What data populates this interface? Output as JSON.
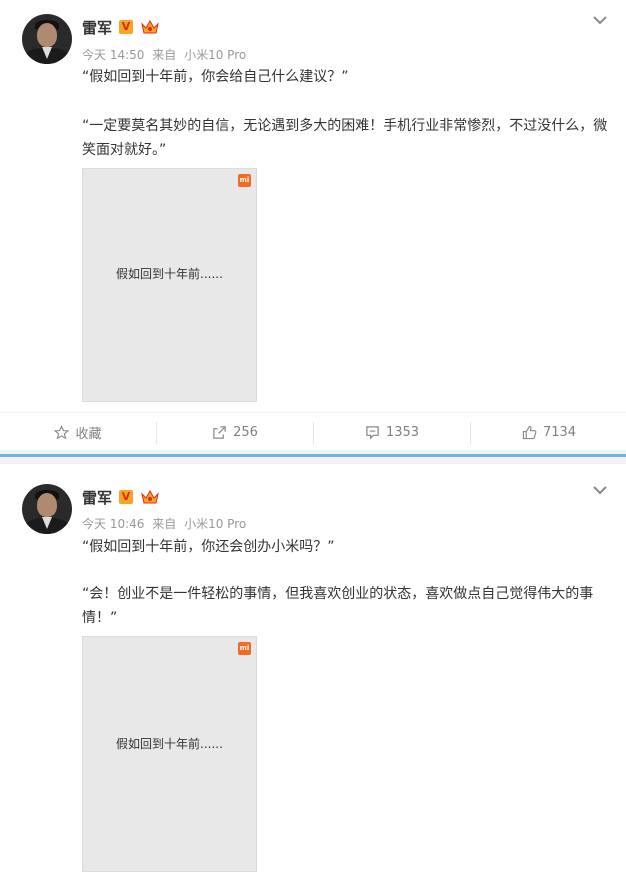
{
  "posts": [
    {
      "username": "雷军",
      "badge": "V",
      "time": "今天 14:50",
      "source_prefix": "来自",
      "source": "小米10 Pro",
      "question": "“假如回到十年前，你会给自己什么建议？”",
      "answer": "“一定要莫名其妙的自信，无论遇到多大的困难！手机行业非常惨烈，不过没什么，微笑面对就好。”",
      "image_caption": "假如回到十年前......",
      "image_logo": "mi",
      "actions": {
        "favorite": "收藏",
        "repost": "256",
        "comment": "1353",
        "like": "7134"
      }
    },
    {
      "username": "雷军",
      "badge": "V",
      "time": "今天 10:46",
      "source_prefix": "来自",
      "source": "小米10 Pro",
      "question": "“假如回到十年前，你还会创办小米吗？”",
      "answer": "“会！创业不是一件轻松的事情，但我喜欢创业的状态，喜欢做点自己觉得伟大的事情！”",
      "image_caption": "假如回到十年前......",
      "image_logo": "mi"
    }
  ],
  "icons": [
    "chevron-down-icon",
    "crown-icon",
    "star-icon",
    "share-icon",
    "comment-icon",
    "thumbs-up-icon"
  ],
  "colors": {
    "accent_line": "#69b5e8",
    "badge_bg": "#f5a623",
    "mi_orange": "#f56a22",
    "meta_gray": "#999999"
  }
}
